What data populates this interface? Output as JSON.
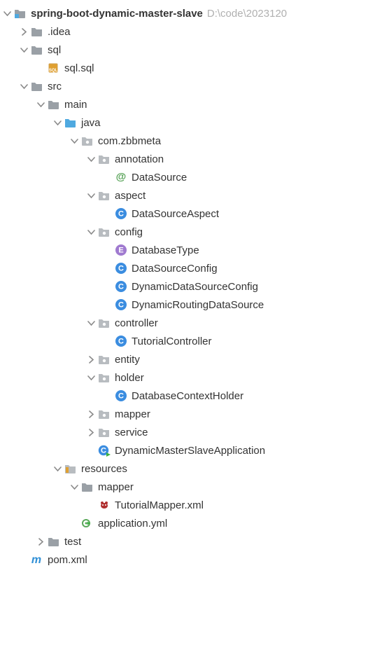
{
  "project": {
    "name": "spring-boot-dynamic-master-slave",
    "path": "D:\\code\\2023120"
  },
  "tree": {
    "idea": ".idea",
    "sql": "sql",
    "sql_file": "sql.sql",
    "src": "src",
    "main": "main",
    "java": "java",
    "pkg": "com.zbbmeta",
    "annotation": "annotation",
    "DataSource": "DataSource",
    "aspect": "aspect",
    "DataSourceAspect": "DataSourceAspect",
    "config": "config",
    "DatabaseType": "DatabaseType",
    "DataSourceConfig": "DataSourceConfig",
    "DynamicDataSourceConfig": "DynamicDataSourceConfig",
    "DynamicRoutingDataSource": "DynamicRoutingDataSource",
    "controller": "controller",
    "TutorialController": "TutorialController",
    "entity": "entity",
    "holder": "holder",
    "DatabaseContextHolder": "DatabaseContextHolder",
    "mapper_pkg": "mapper",
    "service": "service",
    "DynamicMasterSlaveApplication": "DynamicMasterSlaveApplication",
    "resources": "resources",
    "mapper_res": "mapper",
    "TutorialMapperXml": "TutorialMapper.xml",
    "applicationYml": "application.yml",
    "test": "test",
    "pom": "pom.xml"
  }
}
